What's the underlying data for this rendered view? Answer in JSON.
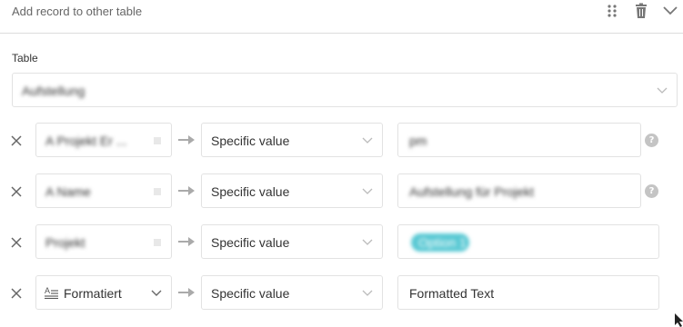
{
  "header": {
    "title": "Add record to other table"
  },
  "table_section": {
    "label": "Table",
    "selected": "Aufstellung"
  },
  "mappings": [
    {
      "source_column": "A Projekt Er ...",
      "mode": "Specific value",
      "value": "pm",
      "value_type": "text",
      "help": "?"
    },
    {
      "source_column": "A Name",
      "mode": "Specific value",
      "value": "Aufstellung für Projekt",
      "value_type": "text",
      "help": "?"
    },
    {
      "source_column": "Projekt",
      "mode": "Specific value",
      "value": "Option 1",
      "value_type": "pill"
    },
    {
      "source_column": "Formatiert",
      "mode": "Specific value",
      "value": "Formatted Text",
      "value_type": "text"
    }
  ],
  "colors": {
    "border": "#e2e2e2",
    "pill": "#59c9d4",
    "help_badge": "#c4c4c4"
  },
  "icons": [
    "drag-handle-icon",
    "trash-icon",
    "chevron-down-icon",
    "close-icon",
    "arrow-right-icon",
    "help-icon",
    "formatted-text-icon"
  ]
}
